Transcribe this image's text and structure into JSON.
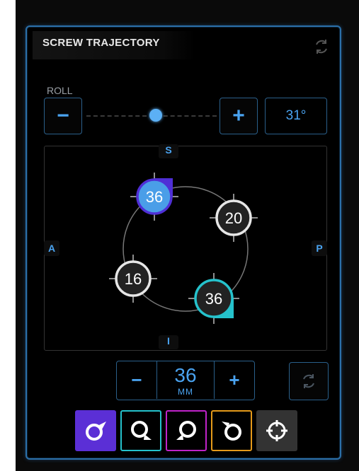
{
  "panel": {
    "title": "SCREW TRAJECTORY"
  },
  "roll": {
    "label": "ROLL",
    "minus_label": "−",
    "plus_label": "+",
    "value_display": "31°",
    "slider_fraction": 0.53
  },
  "orientation": {
    "superior": "S",
    "inferior": "I",
    "anterior": "A",
    "posterior": "P"
  },
  "markers": [
    {
      "value": "36",
      "color": "#4f2fd6",
      "ring": "#4f2fd6",
      "fill": "#4a9ee8"
    },
    {
      "value": "20",
      "color": "#333333",
      "ring": "#e6e6e6",
      "fill": "#222222"
    },
    {
      "value": "16",
      "color": "#333333",
      "ring": "#e6e6e6",
      "fill": "#222222"
    },
    {
      "value": "36",
      "color": "#25c2cc",
      "ring": "#25c2cc",
      "fill": "#222222"
    }
  ],
  "depth": {
    "minus_label": "−",
    "plus_label": "+",
    "value": "36",
    "unit": "MM"
  },
  "tools": [
    {
      "icon": "trajectory-purple-icon",
      "color": "#5b2fd6"
    },
    {
      "icon": "trajectory-cyan-icon",
      "color": "#25c2cc"
    },
    {
      "icon": "trajectory-magenta-icon",
      "color": "#c023c9"
    },
    {
      "icon": "trajectory-orange-icon",
      "color": "#e59a1a"
    },
    {
      "icon": "crosshair-icon",
      "color": "#333333"
    }
  ],
  "colors": {
    "accent": "#4aa3f0",
    "border": "#2a5f8a"
  }
}
